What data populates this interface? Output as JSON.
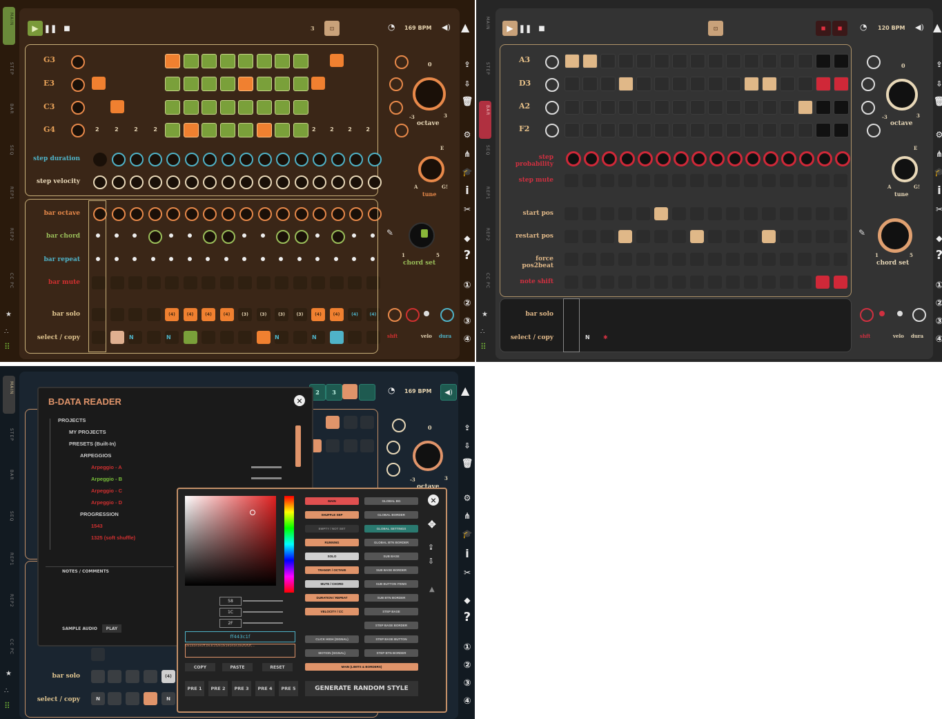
{
  "panel_a": {
    "bpm": "169 BPM",
    "step_num": "3",
    "notes": [
      "G3",
      "E3",
      "C3",
      "G4"
    ],
    "row_labels": [
      "step duration",
      "step velocity",
      "bar octave",
      "bar chord",
      "bar repeat",
      "bar mute",
      "bar solo",
      "select / copy"
    ],
    "octave_label": "octave",
    "octave_val": "0",
    "octave_min": "-3",
    "octave_max": "3",
    "tune_label": "tune",
    "tune_top": "E",
    "tune_left": "A",
    "tune_right": "G!",
    "chord_label": "chord set",
    "chord_min": "1",
    "chord_max": "5",
    "g4_left_vals": [
      "2",
      "2",
      "2",
      "2"
    ],
    "g4_right_vals": [
      "2",
      "2",
      "2",
      "2"
    ],
    "solo_vals": [
      "(4)",
      "(4)",
      "(4)",
      "(4)",
      "(3)",
      "(3)",
      "(3)",
      "(3)",
      "(4)",
      "(4)",
      "(4)",
      "(4)"
    ],
    "select_marks": [
      "N",
      "N",
      "N",
      "N"
    ],
    "bottom_labels": [
      "shft",
      "velo",
      "dura"
    ]
  },
  "panel_b": {
    "bpm": "120 BPM",
    "notes": [
      "A3",
      "D3",
      "A2",
      "F2"
    ],
    "row_labels": [
      "step probability",
      "step mute",
      "start pos",
      "restart pos",
      "force pos2beat",
      "note shift",
      "bar solo",
      "select / copy"
    ],
    "octave_label": "octave",
    "octave_val": "0",
    "octave_min": "-3",
    "octave_max": "3",
    "tune_label": "tune",
    "tune_top": "E",
    "tune_left": "A",
    "tune_right": "G!",
    "chord_label": "chord set",
    "chord_min": "1",
    "chord_max": "5",
    "select_marks": [
      "N",
      "✱"
    ],
    "bottom_labels": [
      "shft",
      "velo",
      "dura"
    ]
  },
  "panel_c": {
    "bpm": "169 BPM",
    "step_num": "3",
    "reader_title": "B-DATA READER",
    "tree": [
      "PROJECTS",
      "MY PROJECTS",
      "PRESETS (Built-In)",
      "ARPEGGIOS",
      "Arpeggio - A",
      "Arpeggio - B",
      "Arpeggio - C",
      "Arpeggio - D",
      "PROGRESSION",
      "1543",
      "1325 (soft shuffle)"
    ],
    "notes_label": "NOTES / COMMENTS",
    "sample_label": "SAMPLE AUDIO",
    "play_label": "PLAY",
    "octave_val": "0",
    "octave_min": "-3",
    "octave_max": "3",
    "octave_label": "octave",
    "hex_value": "ff443c1f",
    "hex_string": "0x1a1e1e1ff,0x3c1f2e,0x1e1e1e,0x2f2f2f,...",
    "rgb_values": [
      "58",
      "1C",
      "2F"
    ],
    "copy_label": "COPY",
    "paste_label": "PASTE",
    "reset_label": "RESET",
    "presets": [
      "PRE 1",
      "PRE 2",
      "PRE 3",
      "PRE 4",
      "PRE 5"
    ],
    "generate_label": "GENERATE RANDOM STYLE",
    "color_buttons_left": [
      "MAIN",
      "SHUFFLE SEP",
      "EMPTY / NOT SET",
      "RUNNING",
      "SOLO",
      "TRANSP. / OCTAVE",
      "MUTE / CHORD",
      "DURATION / REPEAT",
      "VELOCITY / CC"
    ],
    "color_buttons_right": [
      "GLOBAL BG",
      "GLOBAL BORDER",
      "GLOBAL SETTINGS",
      "GLOBAL BTN BORDER",
      "SUB BASE",
      "SUB BASE BORDER",
      "SUB BUTTON ITEMS",
      "SUB BTN BORDER",
      "STEP BASE",
      "STEP BASE BORDER",
      "STEP BASE BUTTON",
      "STEP BTN BORDER"
    ],
    "color_buttons_bottom_left": [
      "CLICK HIGH (SIGNAL)",
      "MOTION (SIGNAL)"
    ],
    "wide_button": "MAIN (LIMITS & BORDERS)",
    "solo_label": "bar solo",
    "select_label": "select / copy",
    "select_marks": [
      "N",
      "N"
    ],
    "solo_val": "(4)"
  }
}
